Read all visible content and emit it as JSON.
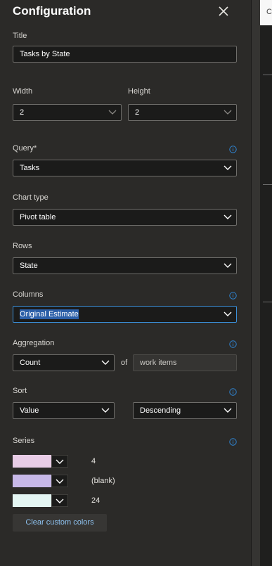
{
  "header": {
    "title": "Configuration"
  },
  "title_field": {
    "label": "Title",
    "value": "Tasks by State"
  },
  "size": {
    "width_label": "Width",
    "width_value": "2",
    "height_label": "Height",
    "height_value": "2"
  },
  "query": {
    "label": "Query*",
    "value": "Tasks"
  },
  "chart_type": {
    "label": "Chart type",
    "value": "Pivot table"
  },
  "rows": {
    "label": "Rows",
    "value": "State"
  },
  "columns": {
    "label": "Columns",
    "value": "Original Estimate"
  },
  "aggregation": {
    "label": "Aggregation",
    "value": "Count",
    "of_label": "of",
    "target": "work items"
  },
  "sort": {
    "label": "Sort",
    "by": "Value",
    "direction": "Descending"
  },
  "series": {
    "label": "Series",
    "items": [
      {
        "value": "4",
        "color": "#e8cce6"
      },
      {
        "value": "(blank)",
        "color": "#c7b8e8"
      },
      {
        "value": "24",
        "color": "#e4f6f3"
      }
    ],
    "clear_label": "Clear custom colors"
  },
  "colors": {
    "accent": "#3a8fd9",
    "info_icon": "#2f86d6",
    "link": "#8ec2f0"
  },
  "right_pane": {
    "glyph": "C"
  }
}
